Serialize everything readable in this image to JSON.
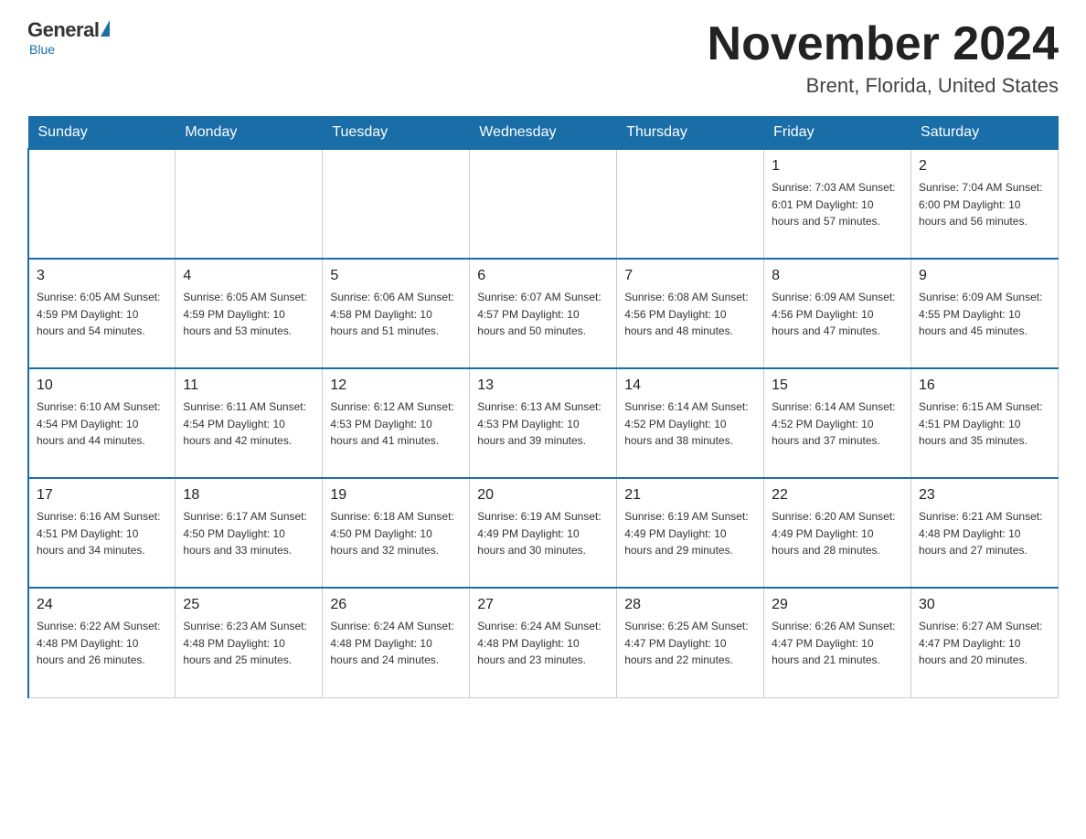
{
  "header": {
    "logo": {
      "general": "General",
      "blue": "Blue"
    },
    "title": "November 2024",
    "subtitle": "Brent, Florida, United States"
  },
  "weekdays": [
    "Sunday",
    "Monday",
    "Tuesday",
    "Wednesday",
    "Thursday",
    "Friday",
    "Saturday"
  ],
  "weeks": [
    [
      {
        "day": "",
        "info": ""
      },
      {
        "day": "",
        "info": ""
      },
      {
        "day": "",
        "info": ""
      },
      {
        "day": "",
        "info": ""
      },
      {
        "day": "",
        "info": ""
      },
      {
        "day": "1",
        "info": "Sunrise: 7:03 AM\nSunset: 6:01 PM\nDaylight: 10 hours and 57 minutes."
      },
      {
        "day": "2",
        "info": "Sunrise: 7:04 AM\nSunset: 6:00 PM\nDaylight: 10 hours and 56 minutes."
      }
    ],
    [
      {
        "day": "3",
        "info": "Sunrise: 6:05 AM\nSunset: 4:59 PM\nDaylight: 10 hours and 54 minutes."
      },
      {
        "day": "4",
        "info": "Sunrise: 6:05 AM\nSunset: 4:59 PM\nDaylight: 10 hours and 53 minutes."
      },
      {
        "day": "5",
        "info": "Sunrise: 6:06 AM\nSunset: 4:58 PM\nDaylight: 10 hours and 51 minutes."
      },
      {
        "day": "6",
        "info": "Sunrise: 6:07 AM\nSunset: 4:57 PM\nDaylight: 10 hours and 50 minutes."
      },
      {
        "day": "7",
        "info": "Sunrise: 6:08 AM\nSunset: 4:56 PM\nDaylight: 10 hours and 48 minutes."
      },
      {
        "day": "8",
        "info": "Sunrise: 6:09 AM\nSunset: 4:56 PM\nDaylight: 10 hours and 47 minutes."
      },
      {
        "day": "9",
        "info": "Sunrise: 6:09 AM\nSunset: 4:55 PM\nDaylight: 10 hours and 45 minutes."
      }
    ],
    [
      {
        "day": "10",
        "info": "Sunrise: 6:10 AM\nSunset: 4:54 PM\nDaylight: 10 hours and 44 minutes."
      },
      {
        "day": "11",
        "info": "Sunrise: 6:11 AM\nSunset: 4:54 PM\nDaylight: 10 hours and 42 minutes."
      },
      {
        "day": "12",
        "info": "Sunrise: 6:12 AM\nSunset: 4:53 PM\nDaylight: 10 hours and 41 minutes."
      },
      {
        "day": "13",
        "info": "Sunrise: 6:13 AM\nSunset: 4:53 PM\nDaylight: 10 hours and 39 minutes."
      },
      {
        "day": "14",
        "info": "Sunrise: 6:14 AM\nSunset: 4:52 PM\nDaylight: 10 hours and 38 minutes."
      },
      {
        "day": "15",
        "info": "Sunrise: 6:14 AM\nSunset: 4:52 PM\nDaylight: 10 hours and 37 minutes."
      },
      {
        "day": "16",
        "info": "Sunrise: 6:15 AM\nSunset: 4:51 PM\nDaylight: 10 hours and 35 minutes."
      }
    ],
    [
      {
        "day": "17",
        "info": "Sunrise: 6:16 AM\nSunset: 4:51 PM\nDaylight: 10 hours and 34 minutes."
      },
      {
        "day": "18",
        "info": "Sunrise: 6:17 AM\nSunset: 4:50 PM\nDaylight: 10 hours and 33 minutes."
      },
      {
        "day": "19",
        "info": "Sunrise: 6:18 AM\nSunset: 4:50 PM\nDaylight: 10 hours and 32 minutes."
      },
      {
        "day": "20",
        "info": "Sunrise: 6:19 AM\nSunset: 4:49 PM\nDaylight: 10 hours and 30 minutes."
      },
      {
        "day": "21",
        "info": "Sunrise: 6:19 AM\nSunset: 4:49 PM\nDaylight: 10 hours and 29 minutes."
      },
      {
        "day": "22",
        "info": "Sunrise: 6:20 AM\nSunset: 4:49 PM\nDaylight: 10 hours and 28 minutes."
      },
      {
        "day": "23",
        "info": "Sunrise: 6:21 AM\nSunset: 4:48 PM\nDaylight: 10 hours and 27 minutes."
      }
    ],
    [
      {
        "day": "24",
        "info": "Sunrise: 6:22 AM\nSunset: 4:48 PM\nDaylight: 10 hours and 26 minutes."
      },
      {
        "day": "25",
        "info": "Sunrise: 6:23 AM\nSunset: 4:48 PM\nDaylight: 10 hours and 25 minutes."
      },
      {
        "day": "26",
        "info": "Sunrise: 6:24 AM\nSunset: 4:48 PM\nDaylight: 10 hours and 24 minutes."
      },
      {
        "day": "27",
        "info": "Sunrise: 6:24 AM\nSunset: 4:48 PM\nDaylight: 10 hours and 23 minutes."
      },
      {
        "day": "28",
        "info": "Sunrise: 6:25 AM\nSunset: 4:47 PM\nDaylight: 10 hours and 22 minutes."
      },
      {
        "day": "29",
        "info": "Sunrise: 6:26 AM\nSunset: 4:47 PM\nDaylight: 10 hours and 21 minutes."
      },
      {
        "day": "30",
        "info": "Sunrise: 6:27 AM\nSunset: 4:47 PM\nDaylight: 10 hours and 20 minutes."
      }
    ]
  ]
}
